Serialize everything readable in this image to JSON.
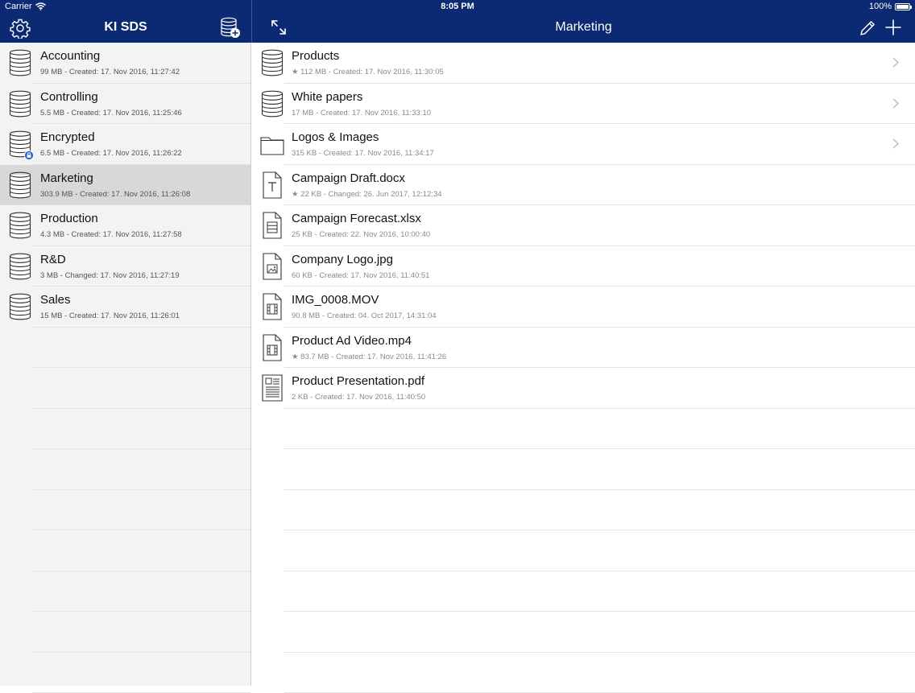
{
  "status_bar": {
    "carrier": "Carrier",
    "time": "8:05 PM",
    "battery": "100%"
  },
  "left_nav": {
    "title": "KI SDS"
  },
  "right_nav": {
    "title": "Marketing"
  },
  "sidebar": {
    "items": [
      {
        "name": "Accounting",
        "meta": "99 MB - Created: 17. Nov 2016, 11:27:42",
        "selected": false,
        "locked": false
      },
      {
        "name": "Controlling",
        "meta": "5.5 MB - Created: 17. Nov 2016, 11:25:46",
        "selected": false,
        "locked": false
      },
      {
        "name": "Encrypted",
        "meta": "6.5 MB - Created: 17. Nov 2016, 11:26:22",
        "selected": false,
        "locked": true
      },
      {
        "name": "Marketing",
        "meta": "303.9 MB - Created: 17. Nov 2016, 11:26:08",
        "selected": true,
        "locked": false
      },
      {
        "name": "Production",
        "meta": "4.3 MB - Created: 17. Nov 2016, 11:27:58",
        "selected": false,
        "locked": false
      },
      {
        "name": "R&D",
        "meta": "3 MB - Changed: 17. Nov 2016, 11:27:19",
        "selected": false,
        "locked": false
      },
      {
        "name": "Sales",
        "meta": "15 MB - Created: 17. Nov 2016, 11:26:01",
        "selected": false,
        "locked": false
      }
    ]
  },
  "files": {
    "items": [
      {
        "name": "Products",
        "meta": "★ 112 MB - Created: 17. Nov 2016, 11:30:05",
        "icon": "database-icon",
        "chevron": true
      },
      {
        "name": "White papers",
        "meta": "17 MB - Created: 17. Nov 2016, 11:33:10",
        "icon": "database-icon",
        "chevron": true
      },
      {
        "name": "Logos & Images",
        "meta": "315 KB - Created: 17. Nov 2016, 11:34:17",
        "icon": "folder-icon",
        "chevron": true
      },
      {
        "name": "Campaign Draft.docx",
        "meta": "★ 22 KB - Changed: 26. Jun 2017, 12:12:34",
        "icon": "text-document-icon",
        "chevron": false
      },
      {
        "name": "Campaign Forecast.xlsx",
        "meta": "25 KB - Created: 22. Nov 2016, 10:00:40",
        "icon": "spreadsheet-icon",
        "chevron": false
      },
      {
        "name": "Company Logo.jpg",
        "meta": "60 KB - Created: 17. Nov 2016, 11:40:51",
        "icon": "image-file-icon",
        "chevron": false
      },
      {
        "name": "IMG_0008.MOV",
        "meta": "90.8 MB - Created: 04. Oct 2017, 14:31:04",
        "icon": "video-file-icon",
        "chevron": false
      },
      {
        "name": "Product Ad Video.mp4",
        "meta": "★ 83.7 MB - Created: 17. Nov 2016, 11:41:26",
        "icon": "video-file-icon",
        "chevron": false
      },
      {
        "name": "Product Presentation.pdf",
        "meta": "2 KB - Created: 17. Nov 2016, 11:40:50",
        "icon": "pdf-file-icon",
        "chevron": false
      }
    ]
  },
  "colors": {
    "navbar": "#0b2a73",
    "sidebar_bg": "#f3f3f3",
    "selected_row": "#d8d8d8",
    "badge": "#2a6bd6"
  }
}
